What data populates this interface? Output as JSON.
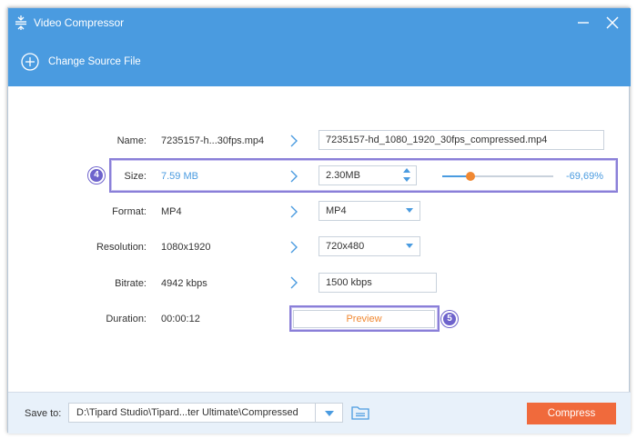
{
  "window": {
    "title": "Video Compressor"
  },
  "toolbar": {
    "change_source_label": "Change Source File"
  },
  "form": {
    "name": {
      "label": "Name:",
      "source": "7235157-h...30fps.mp4",
      "output": "7235157-hd_1080_1920_30fps_compressed.mp4"
    },
    "size": {
      "label": "Size:",
      "source": "7.59 MB",
      "output": "2.30MB",
      "percent": "-69,69%",
      "slider_fraction": 0.25
    },
    "format": {
      "label": "Format:",
      "source": "MP4",
      "output": "MP4"
    },
    "resolution": {
      "label": "Resolution:",
      "source": "1080x1920",
      "output": "720x480"
    },
    "bitrate": {
      "label": "Bitrate:",
      "source": "4942 kbps",
      "output": "1500 kbps"
    },
    "duration": {
      "label": "Duration:",
      "source": "00:00:12"
    }
  },
  "preview_label": "Preview",
  "callouts": {
    "size_step": "4",
    "preview_step": "5"
  },
  "footer": {
    "save_to_label": "Save to:",
    "save_path": "D:\\Tipard Studio\\Tipard...ter Ultimate\\Compressed",
    "compress_label": "Compress"
  },
  "icons": {
    "app": "compress-icon",
    "minimize": "minimize-icon",
    "close": "close-icon",
    "add": "plus-circle-icon",
    "arrow": "chevron-right-icon",
    "folder": "folder-icon"
  },
  "colors": {
    "accent": "#4a9be0",
    "orange": "#f08832",
    "compress_button": "#f06a3c",
    "highlight": "#8a7fd8"
  }
}
